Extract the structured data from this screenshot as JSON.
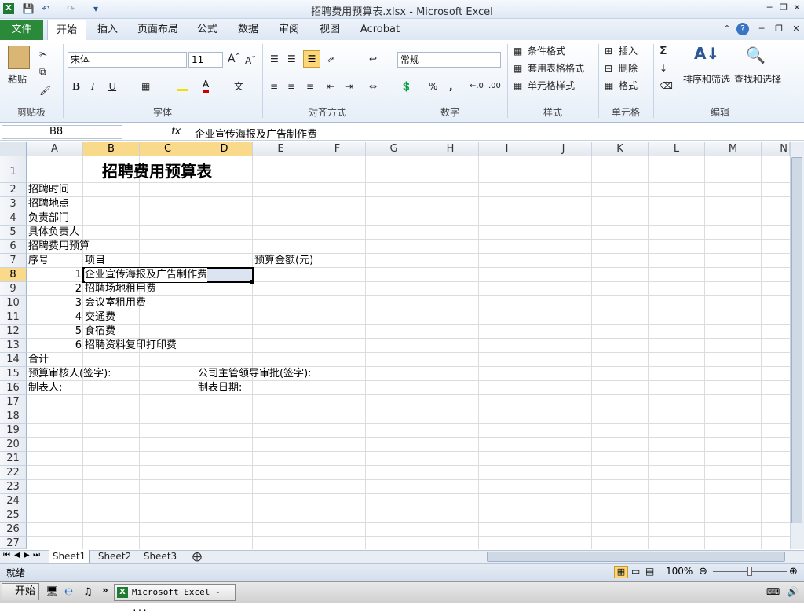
{
  "window": {
    "title": "招聘费用预算表.xlsx - Microsoft Excel"
  },
  "ribbon_tabs": [
    "文件",
    "开始",
    "插入",
    "页面布局",
    "公式",
    "数据",
    "审阅",
    "视图",
    "Acrobat"
  ],
  "ribbon": {
    "paste": "粘贴",
    "font_name": "宋体",
    "font_size": "11",
    "number_format": "常规",
    "cond_format": "条件格式",
    "table_format": "套用表格格式",
    "cell_style": "单元格样式",
    "insert": "插入",
    "delete": "删除",
    "format": "格式",
    "sort_filter": "排序和筛选",
    "find_select": "查找和选择",
    "groups": [
      "剪贴板",
      "字体",
      "对齐方式",
      "数字",
      "样式",
      "单元格",
      "编辑"
    ]
  },
  "formula_bar": {
    "name_box": "B8",
    "fx": "fx",
    "formula": "企业宣传海报及广告制作费"
  },
  "columns": [
    "A",
    "B",
    "C",
    "D",
    "E",
    "F",
    "G",
    "H",
    "I",
    "J",
    "K",
    "L",
    "M",
    "N"
  ],
  "rows": [
    "1",
    "2",
    "3",
    "4",
    "5",
    "6",
    "7",
    "8",
    "9",
    "10",
    "11",
    "12",
    "13",
    "14",
    "15",
    "16",
    "17",
    "18",
    "19",
    "20",
    "21",
    "22",
    "23",
    "24",
    "25",
    "26",
    "27"
  ],
  "cells": {
    "B1": "招聘费用预算表",
    "A2": "招聘时间",
    "A3": "招聘地点",
    "A4": "负责部门",
    "A5": "具体负责人",
    "A6": "招聘费用预算",
    "A7": "序号",
    "B7": "项目",
    "E7": "预算金额(元)",
    "A8": "1",
    "B8": "企业宣传海报及广告制作费",
    "A9": "2",
    "B9": "招聘场地租用费",
    "A10": "3",
    "B10": "会议室租用费",
    "A11": "4",
    "B11": "交通费",
    "A12": "5",
    "B12": "食宿费",
    "A13": "6",
    "B13": "招聘资料复印打印费",
    "A14": "合计",
    "A15": "预算审核人(签字):",
    "D15": "公司主管领导审批(签字):",
    "A16": "制表人:",
    "D16": "制表日期:"
  },
  "sheets": [
    "Sheet1",
    "Sheet2",
    "Sheet3"
  ],
  "status": {
    "ready": "就绪",
    "zoom": "100%"
  },
  "taskbar": {
    "start": "开始",
    "task": "Microsoft Excel - ..."
  }
}
